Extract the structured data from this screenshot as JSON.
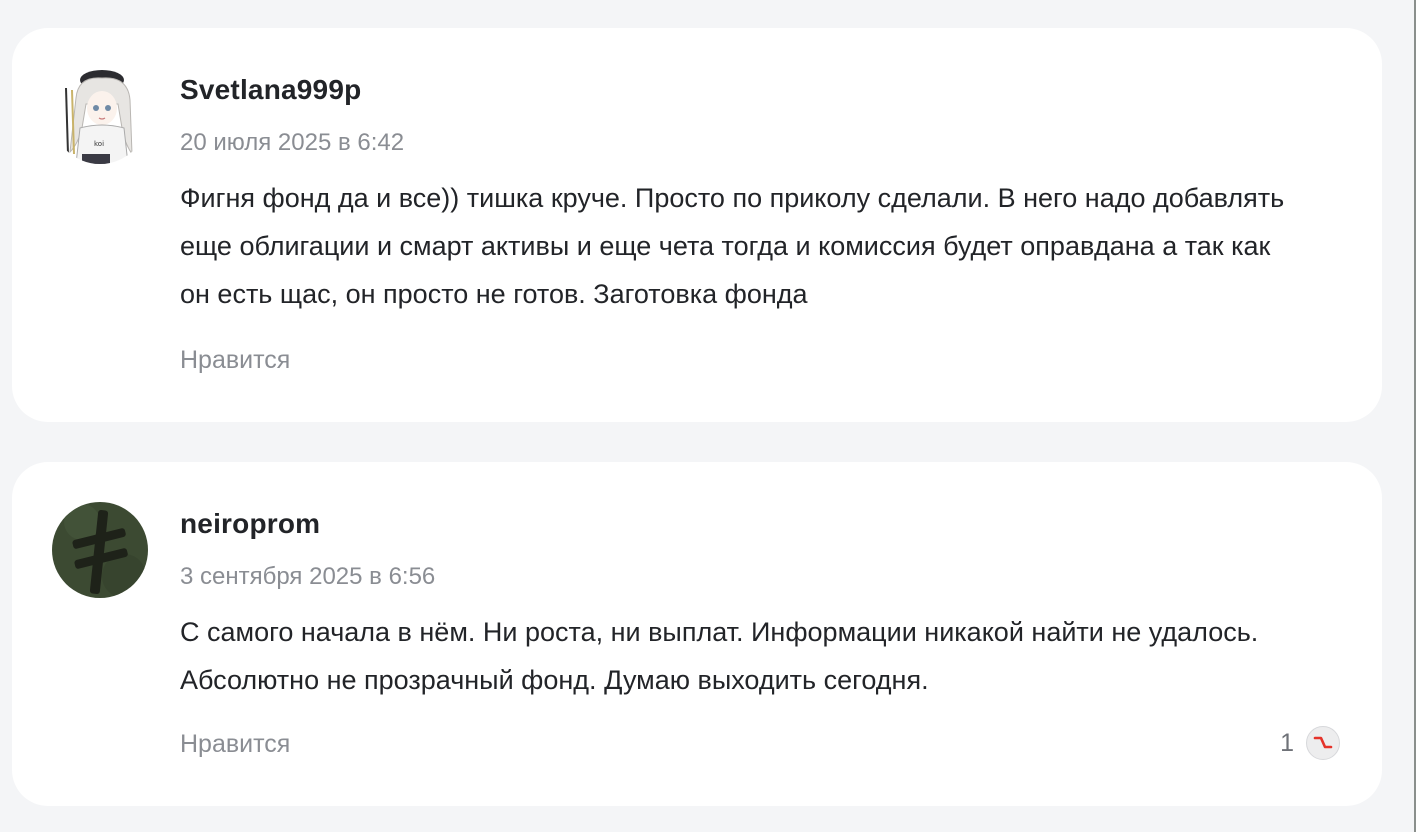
{
  "comments": [
    {
      "author": "Svetlana999p",
      "date": "20 июля 2025 в 6:42",
      "text": "Фигня фонд да и все)) тишка круче. Просто по приколу сделали. В него надо добавлять еще облигации и смарт активы и еще чета тогда и комиссия будет оправдана а так как он есть щас, он просто не готов. Заготовка фонда",
      "like_label": "Нравится"
    },
    {
      "author": "neiroprom",
      "date": "3 сентября 2025 в 6:56",
      "text": "С самого начала в нём. Ни роста, ни выплат. Информации никакой найти не удалось. Абсолютно не прозрачный фонд. Думаю выходить сегодня.",
      "like_label": "Нравится",
      "reaction": {
        "count": "1",
        "icon": "chart-down-icon",
        "color": "#e5332a"
      }
    }
  ],
  "colors": {
    "background": "#f4f5f7",
    "card": "#ffffff",
    "text": "#222428",
    "muted": "#8a8d93"
  }
}
